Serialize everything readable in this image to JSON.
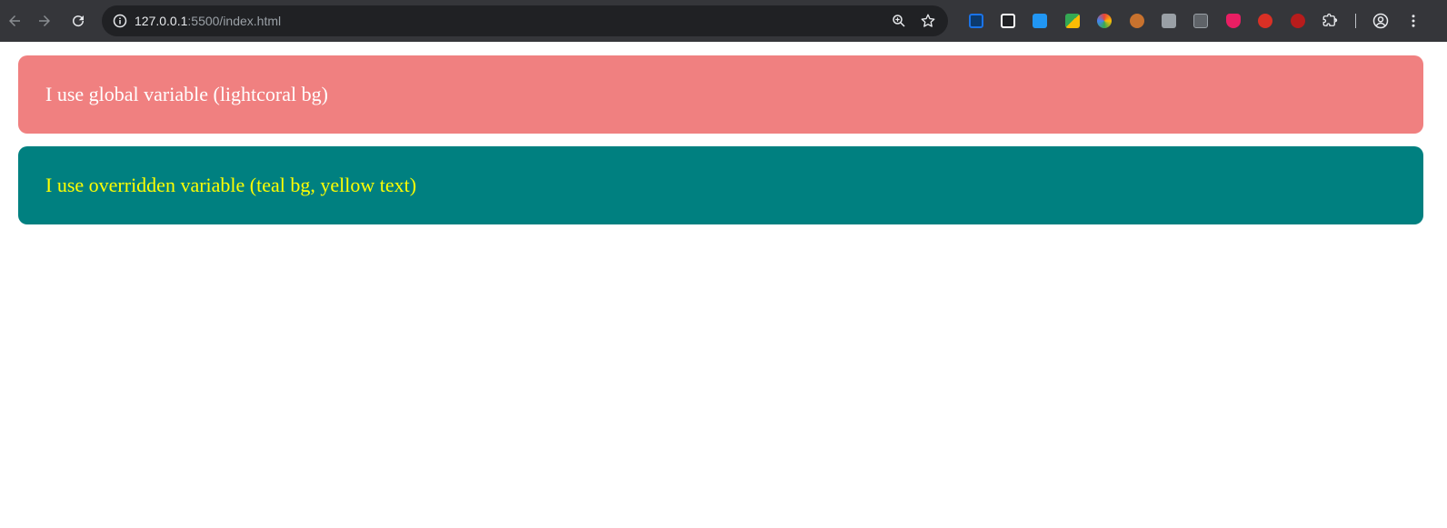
{
  "browser": {
    "url_host": "127.0.0.1",
    "url_rest": ":5500/index.html",
    "icons": {
      "back": "arrow-left-icon",
      "forward": "arrow-right-icon",
      "reload": "reload-icon",
      "site_info": "info-icon",
      "zoom": "zoom-icon",
      "bookmark": "star-icon",
      "extensions": "puzzle-icon",
      "profile": "profile-icon",
      "menu": "kebab-menu-icon"
    },
    "extension_colors": [
      "#1a73e8",
      "#ffffff",
      "#2196f3",
      "#fbbc04",
      "#ea4335",
      "#c8722e",
      "#9aa0a6",
      "#9aa0a6",
      "#e91e63",
      "#d93025",
      "#b71c1c"
    ]
  },
  "page": {
    "box_global_text": "I use global variable (lightcoral bg)",
    "box_override_text": "I use overridden variable (teal bg, yellow text)",
    "colors": {
      "lightcoral": "#f08080",
      "teal": "#008080",
      "yellow": "#ffff00",
      "white": "#ffffff"
    }
  }
}
